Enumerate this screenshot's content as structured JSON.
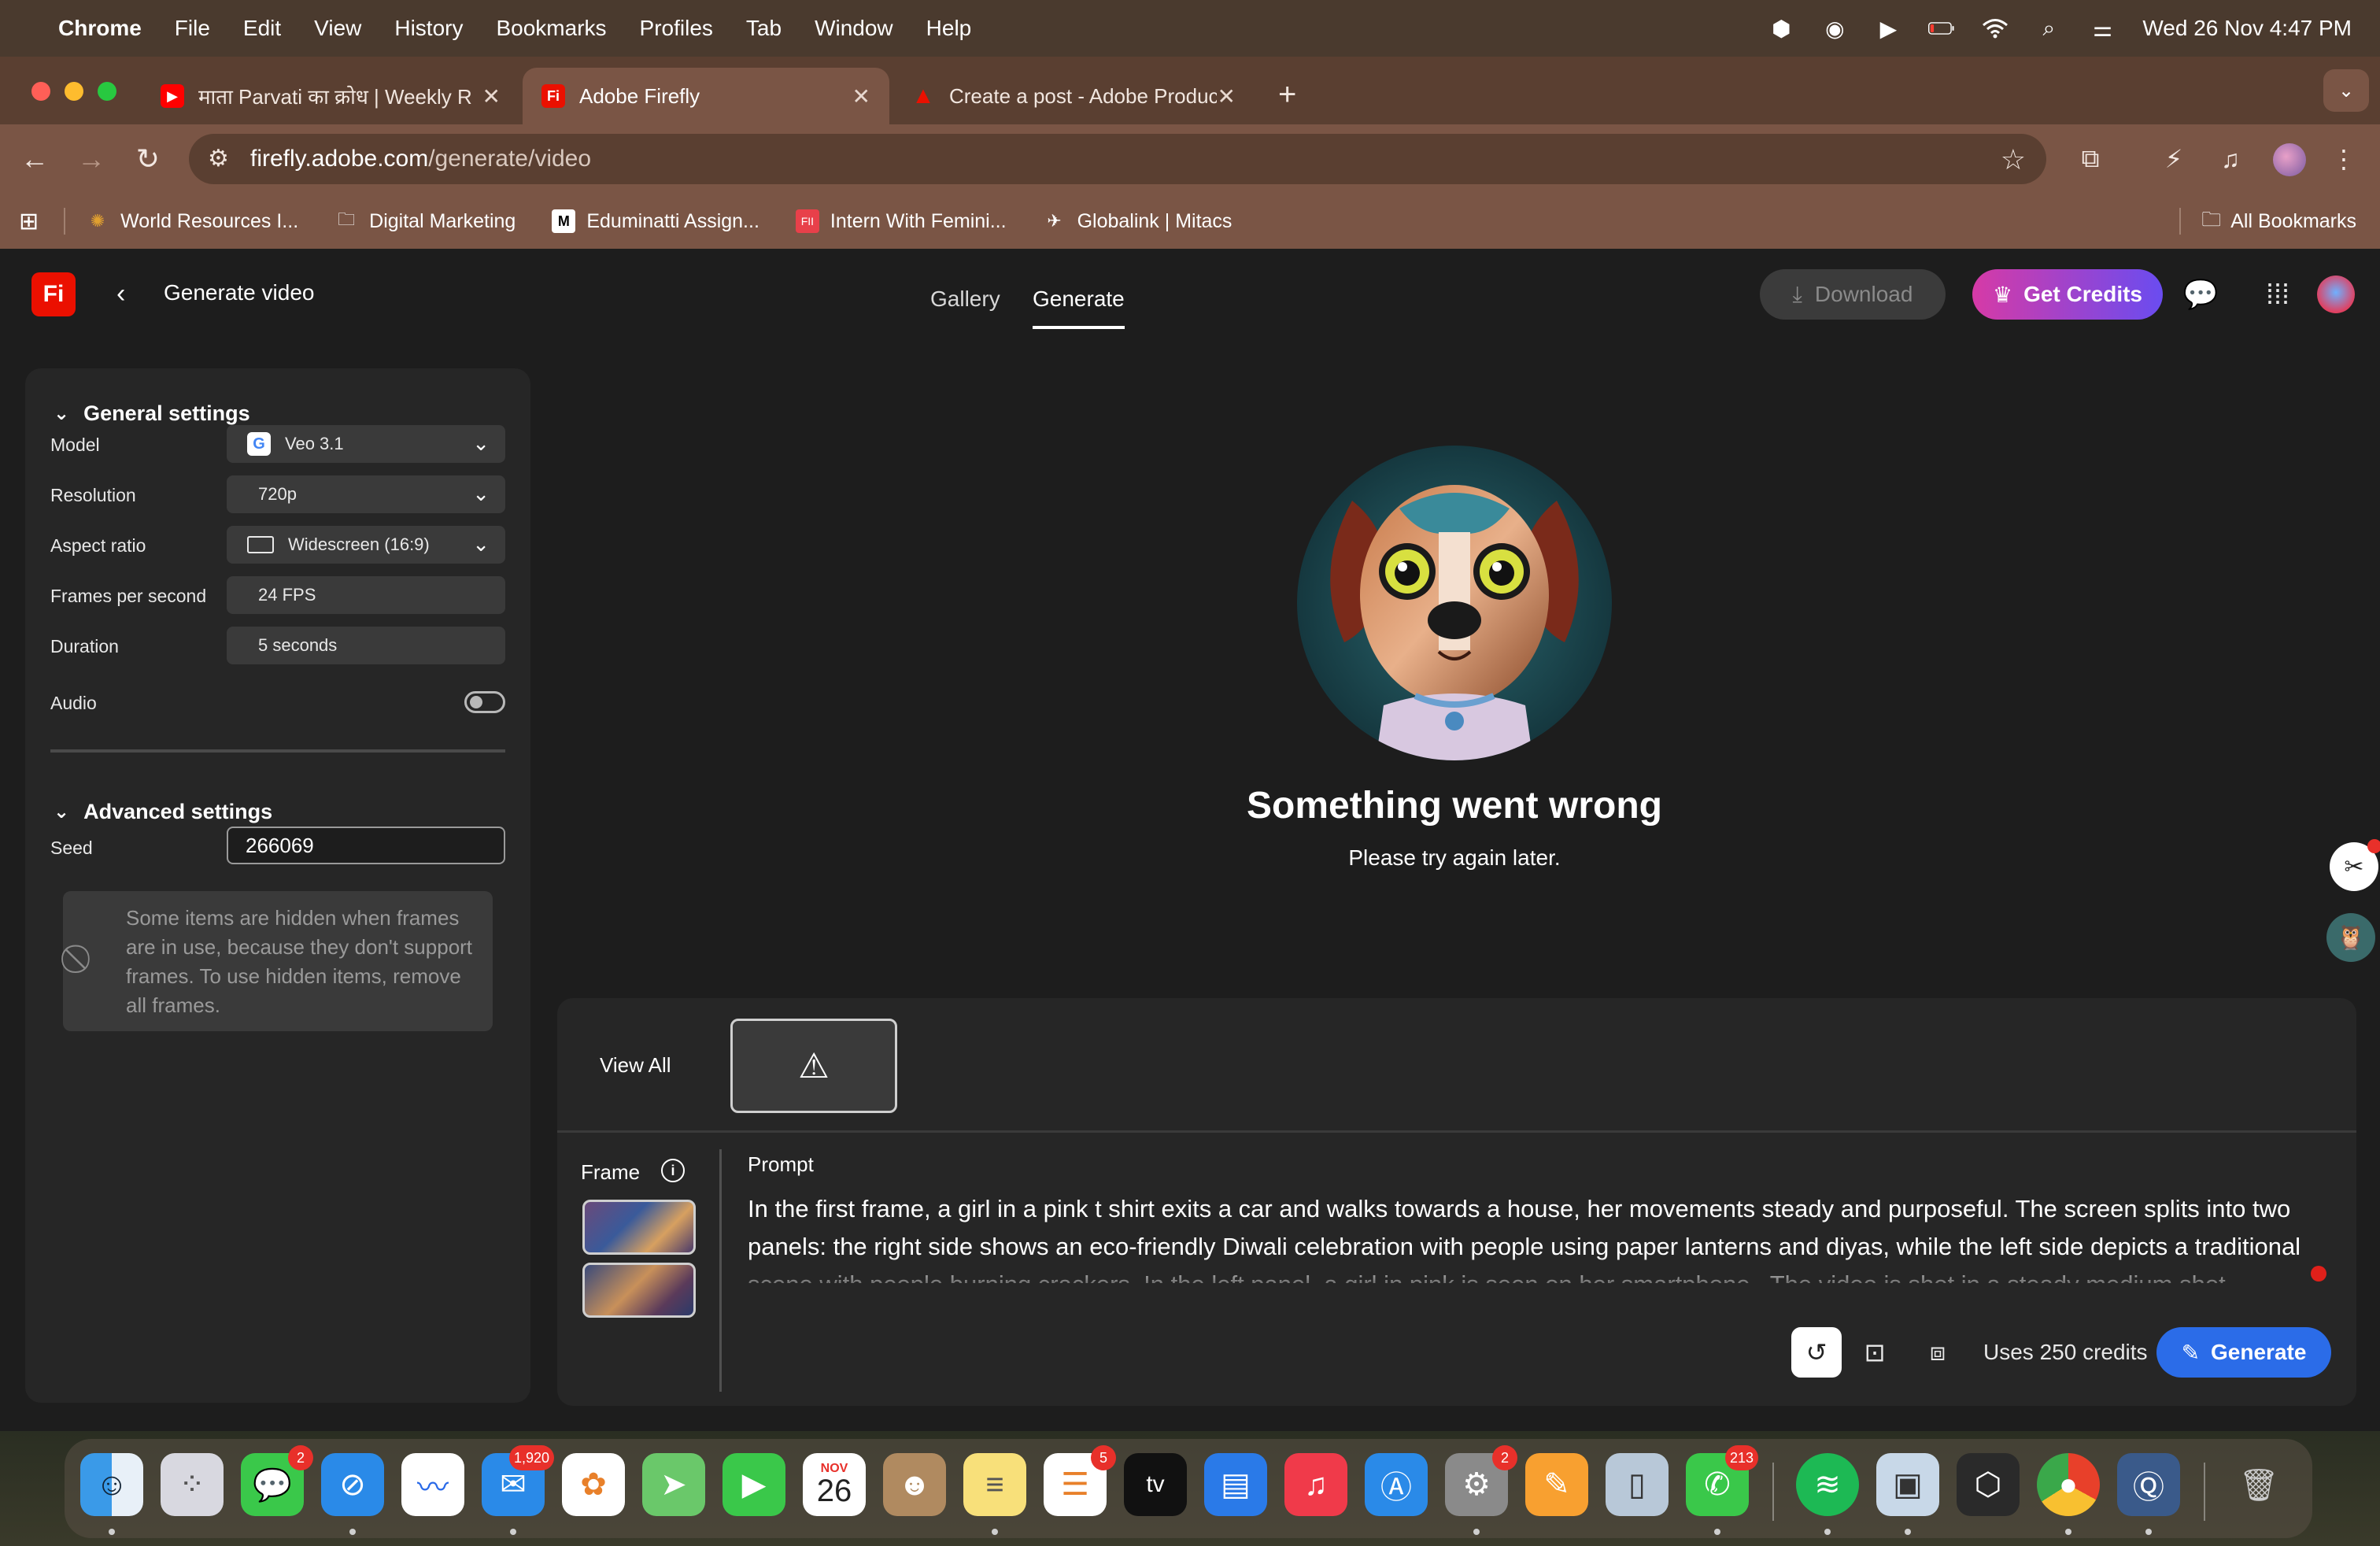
{
  "menubar": {
    "app": "Chrome",
    "items": [
      "File",
      "Edit",
      "View",
      "History",
      "Bookmarks",
      "Profiles",
      "Tab",
      "Window",
      "Help"
    ],
    "datetime": "Wed 26 Nov  4:47 PM"
  },
  "tabs": [
    {
      "label": "माता Parvati का क्रोध | Weekly R",
      "favicon": "youtube-icon",
      "color": "#ff0000"
    },
    {
      "label": "Adobe Firefly",
      "favicon": "firefly-icon",
      "color": "#eb1000"
    },
    {
      "label": "Create a post - Adobe Produc",
      "favicon": "adobe-icon",
      "color": "#eb1000"
    }
  ],
  "address": {
    "host": "firefly.adobe.com",
    "path": "/generate/video"
  },
  "bookmarks": {
    "items": [
      {
        "label": "World Resources I...",
        "icon": "wri-icon"
      },
      {
        "label": "Digital Marketing",
        "icon": "folder-icon"
      },
      {
        "label": "Eduminatti Assign...",
        "icon": "medium-icon"
      },
      {
        "label": "Intern With Femini...",
        "icon": "fi-icon"
      },
      {
        "label": "Globalink | Mitacs",
        "icon": "globalink-icon"
      }
    ],
    "all": "All Bookmarks"
  },
  "app": {
    "logo": "Fi",
    "title": "Generate video",
    "nav": {
      "gallery": "Gallery",
      "generate": "Generate"
    },
    "download": "Download",
    "get_credits": "Get Credits"
  },
  "general": {
    "heading": "General settings",
    "model_label": "Model",
    "model_value": "Veo 3.1",
    "resolution_label": "Resolution",
    "resolution_value": "720p",
    "aspect_label": "Aspect ratio",
    "aspect_value": "Widescreen (16:9)",
    "fps_label": "Frames per second",
    "fps_value": "24 FPS",
    "duration_label": "Duration",
    "duration_value": "5 seconds",
    "audio_label": "Audio",
    "audio_on": false
  },
  "advanced": {
    "heading": "Advanced settings",
    "seed_label": "Seed",
    "seed_value": "266069",
    "info": "Some items are hidden when frames are in use, because they don't support frames. To use hidden items, remove all frames."
  },
  "error": {
    "title": "Something went wrong",
    "subtitle": "Please try again later."
  },
  "bottom": {
    "view_all": "View All",
    "frame_label": "Frame",
    "prompt_label": "Prompt",
    "prompt_text": "In the first frame, a girl in a pink t shirt exits a car and walks towards a house, her movements steady and purposeful. The screen splits into two panels: the right side shows an eco-friendly Diwali celebration with people using paper lanterns and diyas, while the left side depicts a traditional scene with people burning crackers. In the left panel, a girl in pink is seen on her smartphone.. The video is shot in a steady medium shot, maintaining focus on the girl's",
    "credits": "Uses 250 credits",
    "generate": "Generate"
  },
  "dock": {
    "badges": {
      "messages": "2",
      "mail": "1,920",
      "reminders": "5",
      "settings": "2",
      "whatsapp": "213"
    },
    "calendar_month": "NOV",
    "calendar_day": "26",
    "tv_label": "tv"
  }
}
